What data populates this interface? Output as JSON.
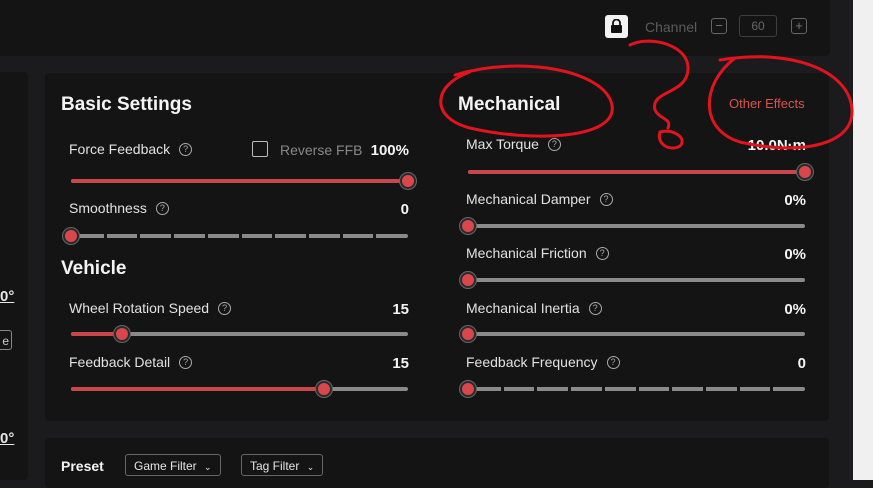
{
  "topbar": {
    "channel_label": "Channel",
    "channel_value": "60",
    "minus": "−",
    "plus": "+"
  },
  "left": {
    "value_1": "0°",
    "value_2": "0°",
    "button": "e"
  },
  "basic": {
    "title": "Basic Settings",
    "force_feedback": {
      "label": "Force Feedback",
      "value": "100%",
      "level": 1.0
    },
    "reverse_ffb": {
      "label": "Reverse FFB",
      "checked": false
    },
    "smoothness": {
      "label": "Smoothness",
      "value": "0",
      "level": 0.0
    }
  },
  "vehicle": {
    "title": "Vehicle",
    "wheel_rotation_speed": {
      "label": "Wheel Rotation Speed",
      "value": "15",
      "level": 0.15
    },
    "feedback_detail": {
      "label": "Feedback Detail",
      "value": "15",
      "level": 0.75
    }
  },
  "mechanical": {
    "title": "Mechanical",
    "other_tab": "Other Effects",
    "max_torque": {
      "label": "Max Torque",
      "value": "10.0N·m",
      "level": 1.0
    },
    "damper": {
      "label": "Mechanical Damper",
      "value": "0%",
      "level": 0.0
    },
    "friction": {
      "label": "Mechanical Friction",
      "value": "0%",
      "level": 0.0
    },
    "inertia": {
      "label": "Mechanical Inertia",
      "value": "0%",
      "level": 0.0
    },
    "feedback_frequency": {
      "label": "Feedback Frequency",
      "value": "0",
      "level": 0.0
    }
  },
  "preset": {
    "title": "Preset",
    "game_filter": "Game Filter",
    "tag_filter": "Tag Filter"
  },
  "colors": {
    "accent": "#d9474c",
    "panel": "#141414",
    "background": "#1b1b1d",
    "annotation": "#e0141e"
  },
  "icons": {
    "lock": "lock-icon",
    "help": "help-circle-icon",
    "chevron": "chevron-down-icon"
  }
}
